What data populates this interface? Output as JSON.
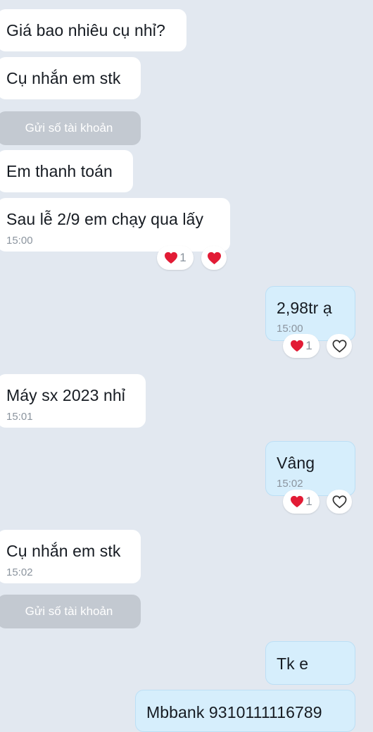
{
  "colors": {
    "background": "#e2e8f0",
    "incoming_bubble": "#ffffff",
    "outgoing_bubble": "#d6eefc",
    "action_button": "#c3c9d1",
    "heart_red": "#e21b35",
    "time_gray": "#8b949e"
  },
  "messages": [
    {
      "id": "m1",
      "side": "incoming",
      "text": "Giá bao nhiêu cụ nhỉ?"
    },
    {
      "id": "m2",
      "side": "incoming",
      "text": "Cụ nhắn em stk"
    },
    {
      "id": "a1",
      "type": "action",
      "label": "Gửi số tài khoản"
    },
    {
      "id": "m3",
      "side": "incoming",
      "text": "Em thanh toán"
    },
    {
      "id": "m4",
      "side": "incoming",
      "text": "Sau lễ 2/9 em chạy qua lấy",
      "time": "15:00",
      "reactions": {
        "heart_count": "1",
        "quick_reaction": "heart-filled"
      }
    },
    {
      "id": "m5",
      "side": "outgoing",
      "text": "2,98tr ạ",
      "time": "15:00",
      "reactions": {
        "heart_count": "1",
        "quick_reaction": "heart-outline"
      }
    },
    {
      "id": "m6",
      "side": "incoming",
      "text": "Máy sx 2023 nhỉ",
      "time": "15:01"
    },
    {
      "id": "m7",
      "side": "outgoing",
      "text": "Vâng",
      "time": "15:02",
      "reactions": {
        "heart_count": "1",
        "quick_reaction": "heart-outline"
      }
    },
    {
      "id": "m8",
      "side": "incoming",
      "text": "Cụ nhắn em stk",
      "time": "15:02"
    },
    {
      "id": "a2",
      "type": "action",
      "label": "Gửi số tài khoản"
    },
    {
      "id": "m9",
      "side": "outgoing",
      "text": "Tk e"
    },
    {
      "id": "m10",
      "side": "outgoing",
      "text": "Mbbank 9310111116789"
    }
  ]
}
